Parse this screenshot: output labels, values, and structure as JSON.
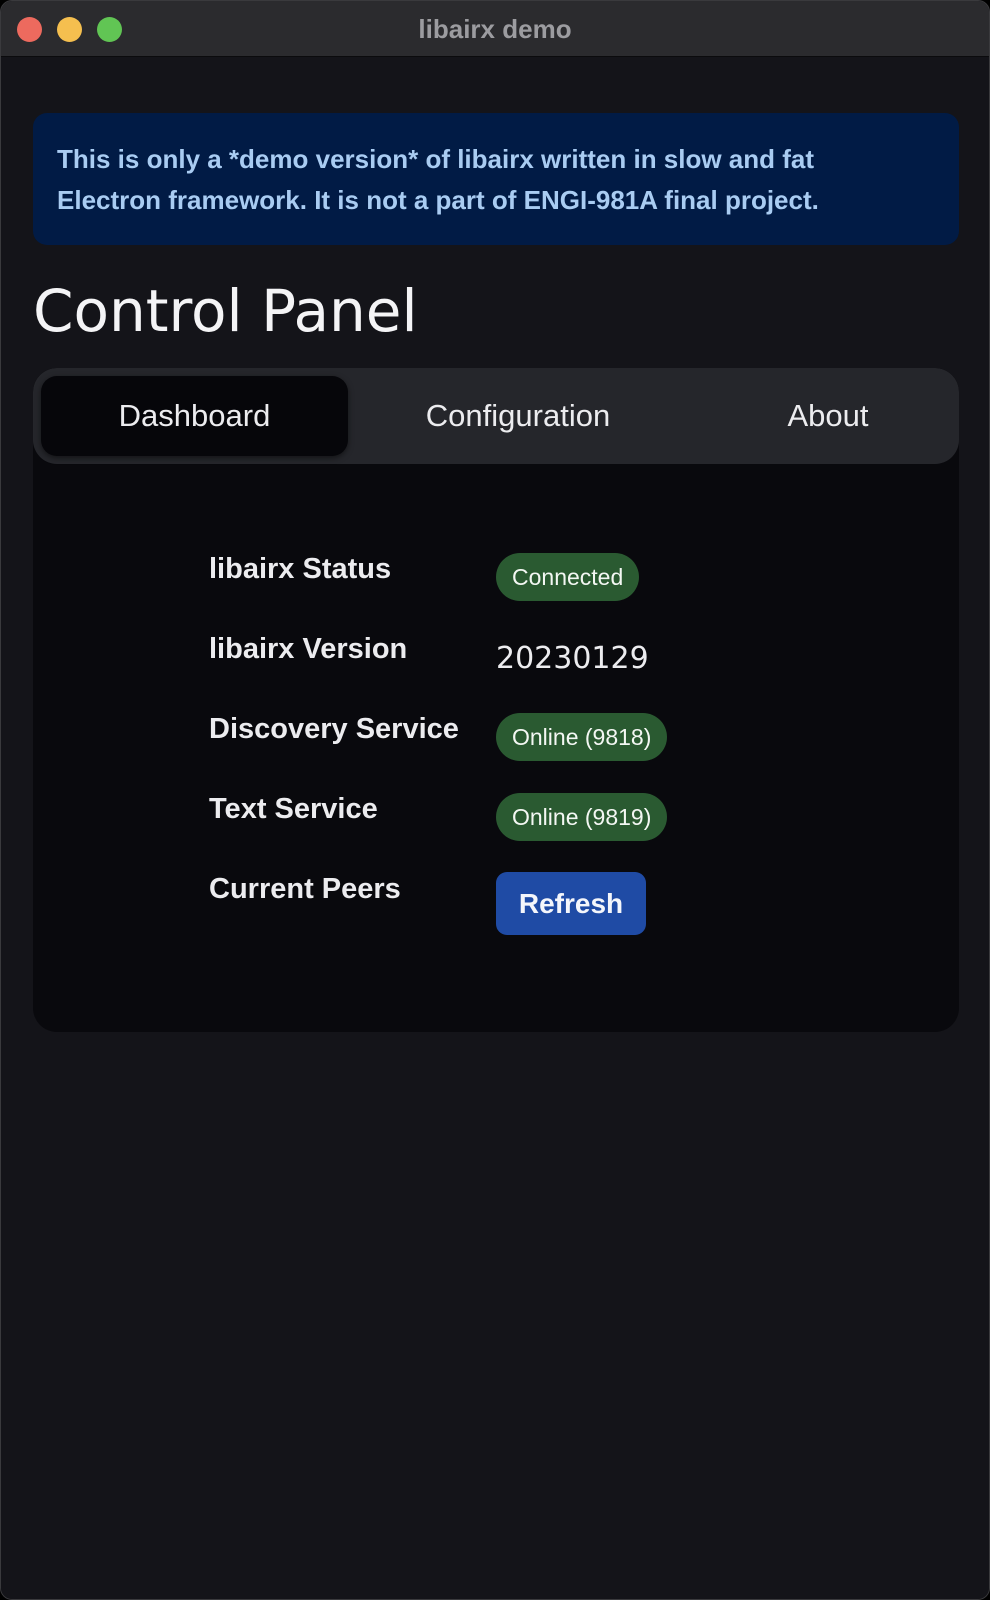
{
  "window": {
    "title": "libairx demo",
    "controls": {
      "close_color": "#ed6a5e",
      "minimize_color": "#f5bf4f",
      "maximize_color": "#61c554"
    }
  },
  "banner": {
    "lines": [
      "This is only a *demo version* of libairx written in slow and fat",
      "Electron framework. It is not a part of ENGI-981A final project."
    ]
  },
  "page": {
    "title": "Control Panel"
  },
  "tabs": [
    {
      "label": "Dashboard",
      "selected": true
    },
    {
      "label": "Configuration",
      "selected": false
    },
    {
      "label": "About",
      "selected": false
    }
  ],
  "dashboard": {
    "status": {
      "label": "libairx Status",
      "value": "Connected"
    },
    "version": {
      "label": "libairx Version",
      "value": "20230129"
    },
    "discovery": {
      "label": "Discovery Service",
      "value": "Online (9818)"
    },
    "text_service": {
      "label": "Text Service",
      "value": "Online (9819)"
    },
    "peers": {
      "label": "Current Peers",
      "button_label": "Refresh"
    }
  },
  "colors": {
    "background": "#141419",
    "banner_bg": "#011b45",
    "banner_text": "#a9ccf2",
    "badge_green": "#2a5a31",
    "button_blue": "#1f4ba5"
  }
}
